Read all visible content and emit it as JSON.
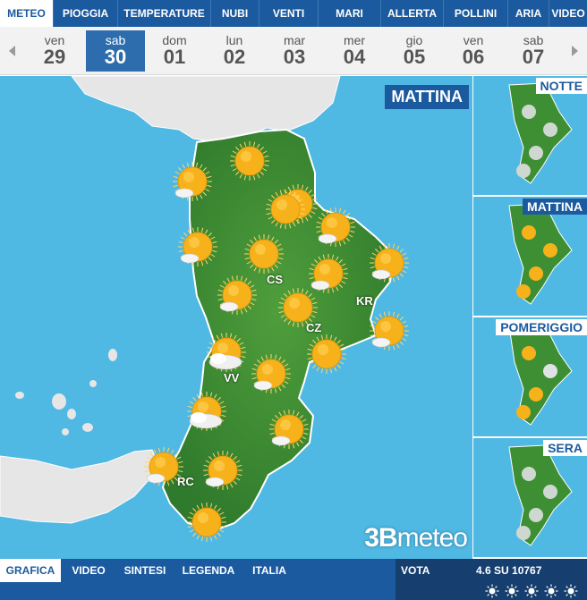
{
  "nav": {
    "tabs": [
      {
        "label": "METEO",
        "active": true
      },
      {
        "label": "PIOGGIA"
      },
      {
        "label": "TEMPERATURE"
      },
      {
        "label": "NUBI"
      },
      {
        "label": "VENTI"
      },
      {
        "label": "MARI"
      },
      {
        "label": "ALLERTA"
      },
      {
        "label": "POLLINI"
      },
      {
        "label": "ARIA"
      },
      {
        "label": "VIDEO"
      }
    ]
  },
  "days": [
    {
      "name": "ven",
      "num": "29"
    },
    {
      "name": "sab",
      "num": "30",
      "active": true
    },
    {
      "name": "dom",
      "num": "01"
    },
    {
      "name": "lun",
      "num": "02"
    },
    {
      "name": "mar",
      "num": "03"
    },
    {
      "name": "mer",
      "num": "04"
    },
    {
      "name": "gio",
      "num": "05"
    },
    {
      "name": "ven",
      "num": "06"
    },
    {
      "name": "sab",
      "num": "07"
    }
  ],
  "map": {
    "period": "MATTINA",
    "cities": [
      "CS",
      "KR",
      "CZ",
      "VV",
      "RC"
    ],
    "logo_brand": "3B",
    "logo_text": "meteo",
    "colors": {
      "sea": "#4fb8e3",
      "land": "#3e8f33",
      "neighbor_land": "#e8e8e8",
      "sun": "#f7b21b"
    },
    "icons": [
      "sun-partly-cloudy",
      "sun",
      "sun",
      "sun-partly-cloudy",
      "sun",
      "sun-partly-cloudy",
      "sun-partly-cloudy",
      "sun",
      "sun-partly-cloudy",
      "sun-partly-cloudy",
      "sun",
      "sun-partly-cloudy",
      "sun",
      "cloudy-sun",
      "sun-partly-cloudy",
      "cloudy-sun",
      "sun-partly-cloudy",
      "sun-partly-cloudy",
      "sun-partly-cloudy",
      "sun"
    ]
  },
  "side": {
    "thumbs": [
      {
        "label": "NOTTE"
      },
      {
        "label": "MATTINA",
        "active": true
      },
      {
        "label": "POMERIGGIO"
      },
      {
        "label": "SERA"
      }
    ]
  },
  "bottom": {
    "tabs": [
      {
        "label": "GRAFICA",
        "active": true
      },
      {
        "label": "VIDEO"
      },
      {
        "label": "SINTESI"
      },
      {
        "label": "LEGENDA"
      },
      {
        "label": "ITALIA"
      }
    ],
    "vote_label": "VOTA",
    "vote_score": "4.6 SU 10767",
    "stars": 5
  },
  "icon_names": {
    "prev": "arrow-left-icon",
    "next": "arrow-right-icon",
    "star": "sun-star-icon"
  }
}
